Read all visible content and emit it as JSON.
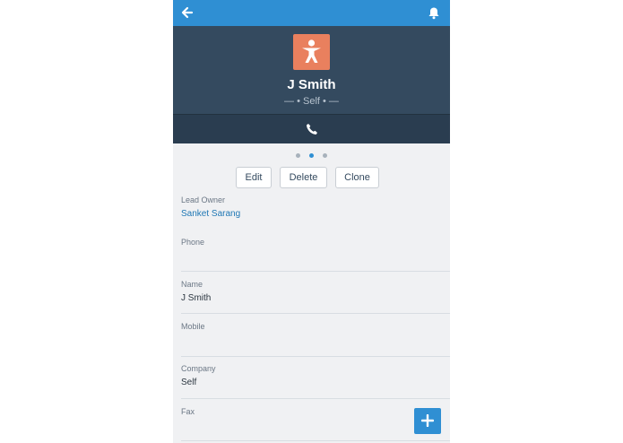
{
  "header": {
    "back_icon": "back-arrow-icon",
    "bell_icon": "bell-icon",
    "color": "#2f8fd3"
  },
  "record": {
    "avatar_icon": "person-icon",
    "avatar_color": "#e9805e",
    "name": "J Smith",
    "subtitle": "— • Self • —"
  },
  "callbar": {
    "icon": "phone-icon"
  },
  "pager": {
    "pages": 3,
    "active": 2
  },
  "actions": {
    "edit": "Edit",
    "delete": "Delete",
    "clone": "Clone"
  },
  "fields": [
    {
      "label": "Lead Owner",
      "value": "Sanket Sarang"
    },
    {
      "label": "Phone",
      "value": ""
    },
    {
      "label": "Name",
      "value": "J Smith"
    },
    {
      "label": "Mobile",
      "value": ""
    },
    {
      "label": "Company",
      "value": "Self"
    },
    {
      "label": "Fax",
      "value": ""
    }
  ],
  "fab": {
    "icon": "plus-icon"
  }
}
